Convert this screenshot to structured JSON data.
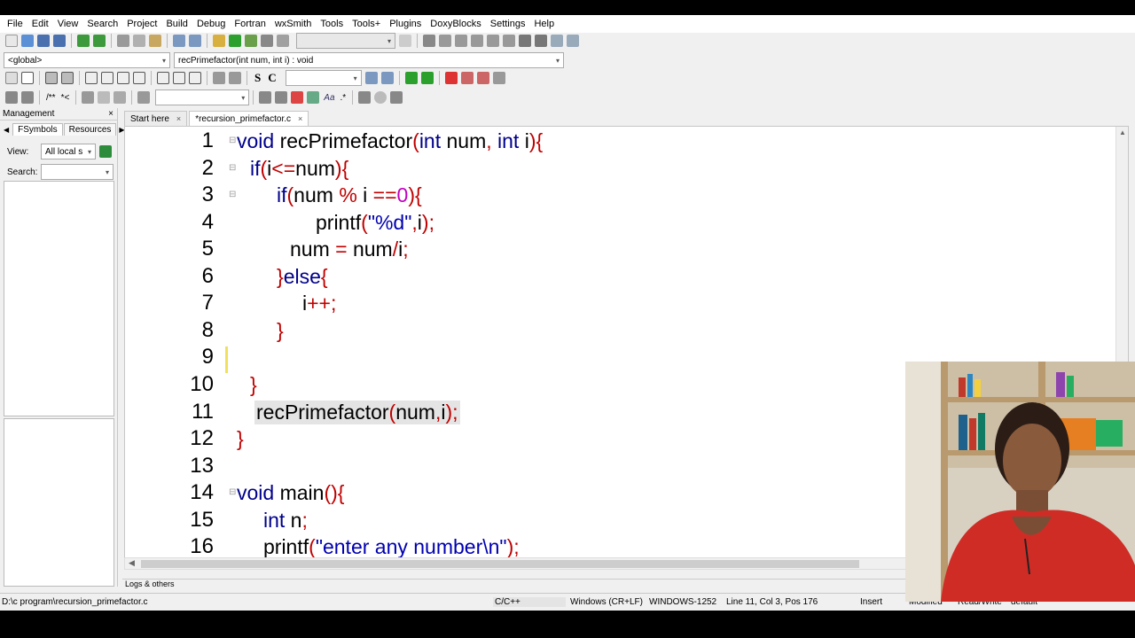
{
  "menu": [
    "File",
    "Edit",
    "View",
    "Search",
    "Project",
    "Build",
    "Debug",
    "Fortran",
    "wxSmith",
    "Tools",
    "Tools+",
    "Plugins",
    "DoxyBlocks",
    "Settings",
    "Help"
  ],
  "scope_combo": "<global>",
  "function_combo": "recPrimefactor(int num, int i) : void",
  "toolbar": {
    "search_text": "S",
    "search_case": "C",
    "abc_label": "Aa"
  },
  "management": {
    "title": "Management",
    "close": "×",
    "tabs": [
      "FSymbols",
      "Resources"
    ],
    "view_label": "View:",
    "view_value": "All local s",
    "search_label": "Search:"
  },
  "editor_tabs": [
    {
      "label": "Start here",
      "close": "×"
    },
    {
      "label": "*recursion_primefactor.c",
      "close": "×"
    }
  ],
  "line_numbers": [
    "1",
    "2",
    "3",
    "4",
    "5",
    "6",
    "7",
    "8",
    "9",
    "10",
    "11",
    "12",
    "13",
    "14",
    "15",
    "16"
  ],
  "code": {
    "l1": {
      "a": "void",
      "b": " recPrimefactor",
      "c": "(",
      "d": "int",
      "e": " num",
      "f": ",",
      "g": " int",
      "h": " i",
      "i": "){"
    },
    "l2": {
      "a": "if",
      "b": "(",
      "c": "i",
      "d": "<=",
      "e": "num",
      "f": "){"
    },
    "l3": {
      "a": "if",
      "b": "(",
      "c": "num ",
      "d": "%",
      "e": " i ",
      "f": "==",
      "g": "0",
      "h": "){"
    },
    "l4": {
      "a": "printf",
      "b": "(",
      "c": "\"%d\"",
      "d": ",",
      "e": "i",
      "f": ");"
    },
    "l5": {
      "a": "num ",
      "b": "=",
      "c": " num",
      "d": "/",
      "e": "i",
      "f": ";"
    },
    "l6": {
      "a": "}",
      "b": "else",
      "c": "{"
    },
    "l7": {
      "a": "i",
      "b": "++;"
    },
    "l8": {
      "a": "}"
    },
    "l10": {
      "a": "}"
    },
    "l11": {
      "a": "recPrimefactor",
      "b": "(",
      "c": "num",
      "d": ",",
      "e": "i",
      "f": ");"
    },
    "l12": {
      "a": "}"
    },
    "l14": {
      "a": "void",
      "b": " main",
      "c": "(){"
    },
    "l15": {
      "a": "int",
      "b": " n",
      "c": ";"
    },
    "l16": {
      "a": "printf",
      "b": "(",
      "c": "\"enter any number\\n\"",
      "d": ");"
    }
  },
  "logs_tab": "Logs & others",
  "status": {
    "path": "D:\\c program\\recursion_primefactor.c",
    "language": "C/C++",
    "eol": "Windows (CR+LF)",
    "encoding": "WINDOWS-1252",
    "position": "Line 11, Col 3, Pos 176",
    "mode": "Insert",
    "modified": "Modified",
    "rw": "Read/Write",
    "profile": "default"
  },
  "colors": {
    "keyword": "#00008b",
    "punct": "#c00000",
    "string": "#0000b0",
    "number": "#c000c0",
    "highlight": "#e4e4e4"
  }
}
